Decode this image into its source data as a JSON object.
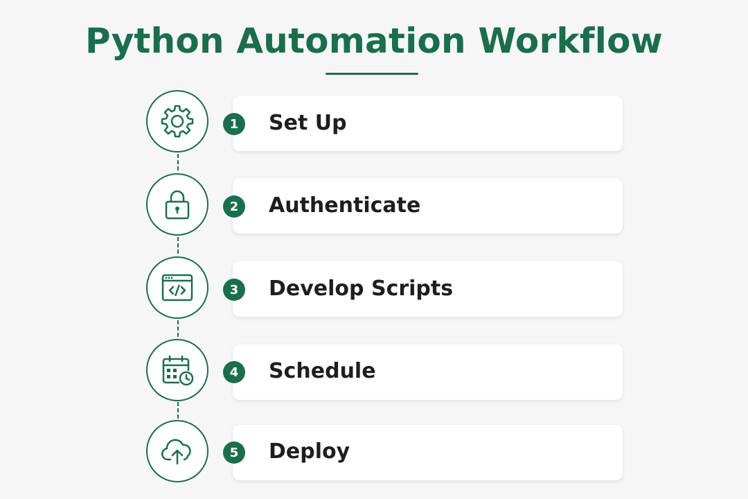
{
  "title": "Python Automation Workflow",
  "accent_color": "#1b6e4c",
  "steps": [
    {
      "number": "1",
      "label": "Set Up",
      "icon": "gear-icon"
    },
    {
      "number": "2",
      "label": "Authenticate",
      "icon": "padlock-icon"
    },
    {
      "number": "3",
      "label": "Develop Scripts",
      "icon": "code-window-icon"
    },
    {
      "number": "4",
      "label": "Schedule",
      "icon": "calendar-clock-icon"
    },
    {
      "number": "5",
      "label": "Deploy",
      "icon": "cloud-upload-icon"
    }
  ]
}
